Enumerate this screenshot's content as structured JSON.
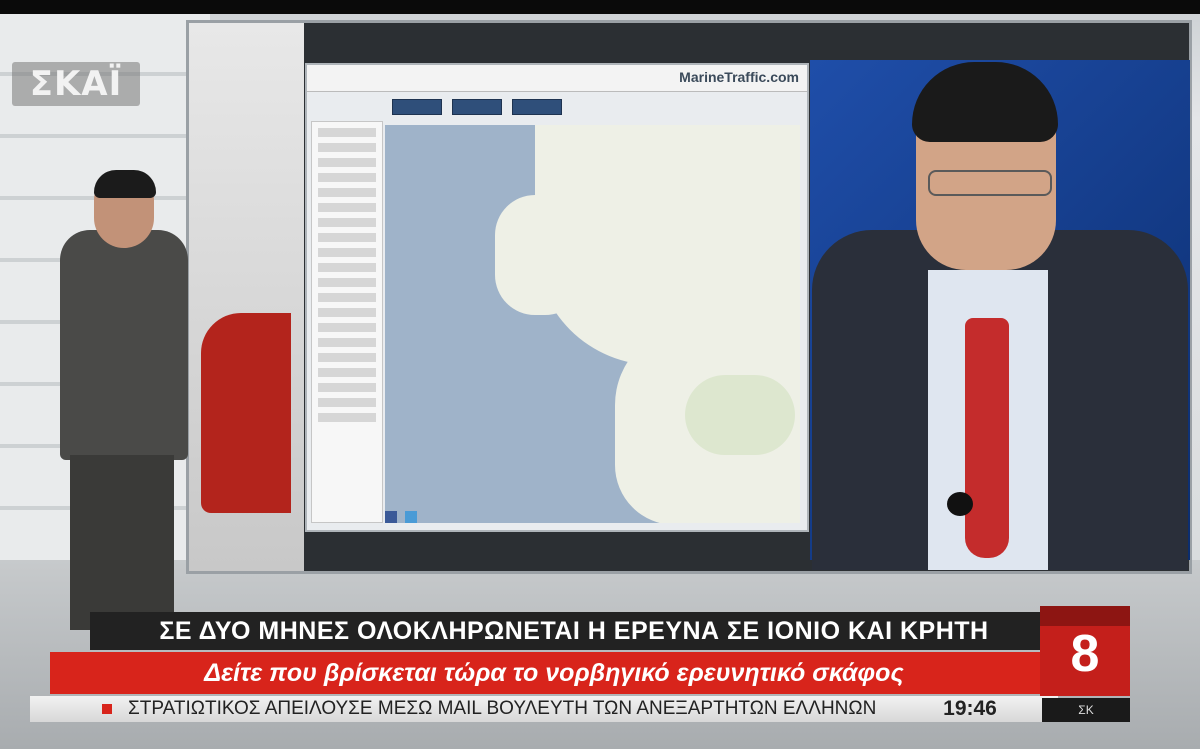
{
  "broadcast": {
    "logo": "ΣΚΑΪ",
    "channel_number": "8",
    "channel_badge": "ΣΚ"
  },
  "screen": {
    "site_title": "MarineTraffic.com"
  },
  "lower_third": {
    "headline": "ΣΕ ΔΥΟ ΜΗΝΕΣ ΟΛΟΚΛΗΡΩΝΕΤΑΙ Η ΕΡΕΥΝΑ ΣΕ ΙΟΝΙΟ ΚΑΙ ΚΡΗΤΗ",
    "subheadline": "Δείτε που βρίσκεται τώρα το νορβηγικό ερευνητικό σκάφος",
    "crawl": "ΣΤΡΑΤΙΩΤΙΚΟΣ ΑΠΕΙΛΟΥΣΕ ΜΕΣΩ MAIL ΒΟΥΛΕΥΤΗ ΤΩΝ ΑΝΕΞΑΡΤΗΤΩΝ ΕΛΛΗΝΩΝ",
    "clock": "19:46"
  },
  "colors": {
    "headline_bg": "#222222",
    "subhead_bg": "#d8241b",
    "crawl_bg": "#e6e6e6",
    "channel_cube": "#c41f1b"
  }
}
